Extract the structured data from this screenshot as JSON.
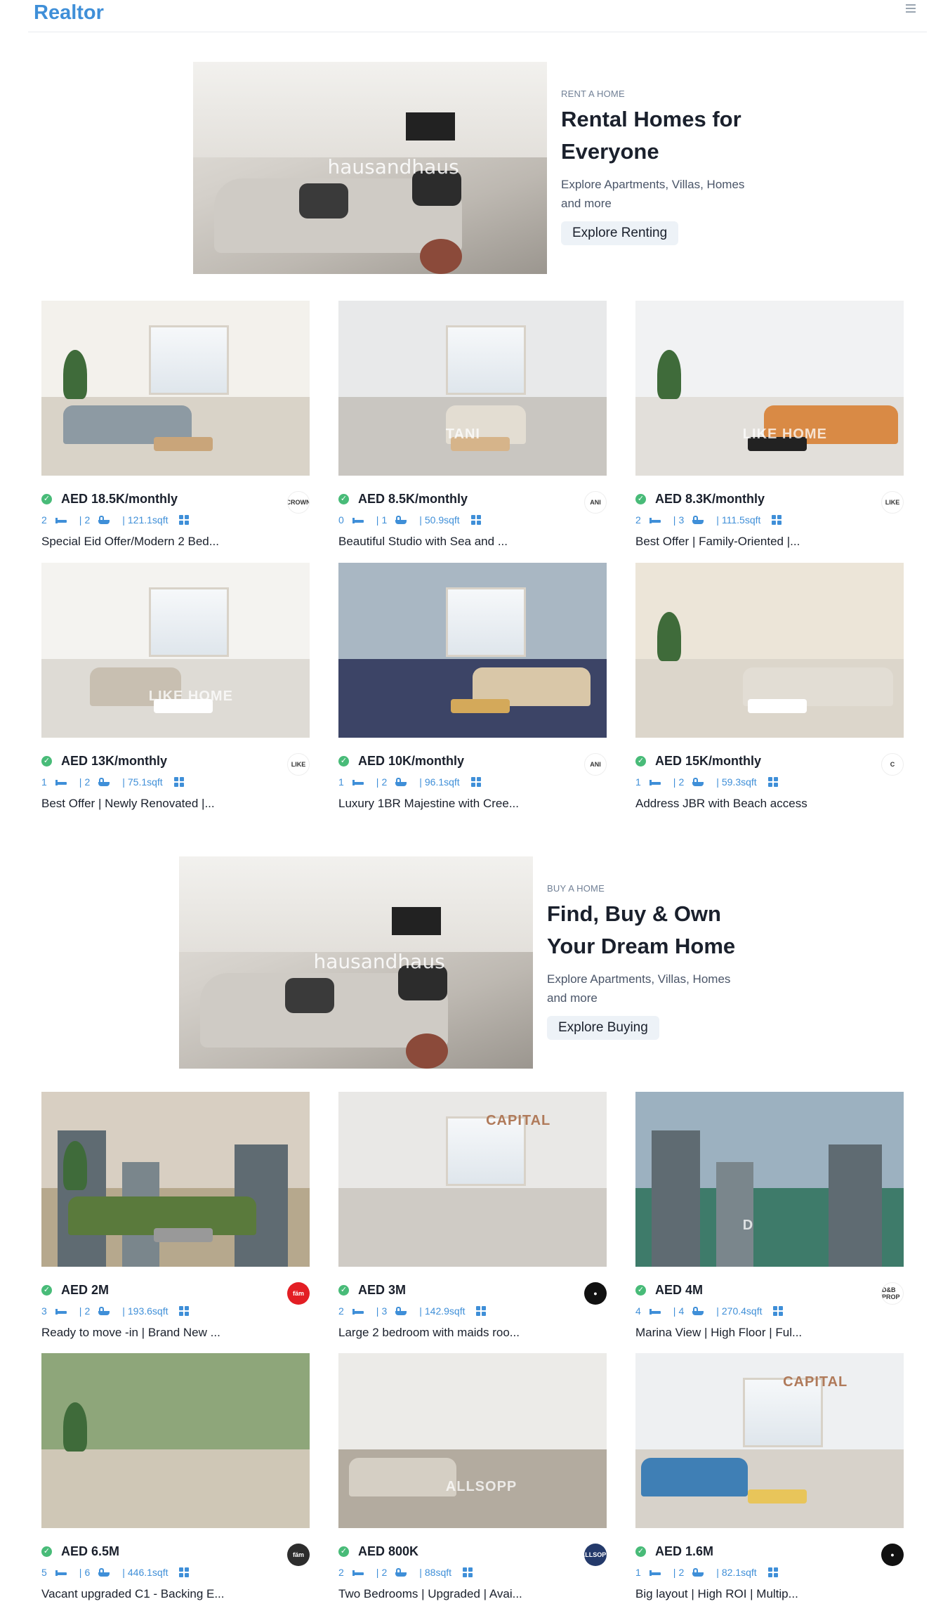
{
  "navbar": {
    "logo": "Realtor",
    "menu_icon": "menu-icon"
  },
  "rent_banner": {
    "tag": "RENT A HOME",
    "title": "Rental Homes for Everyone",
    "description": "Explore Apartments, Villas, Homes and more",
    "button": "Explore Renting",
    "image_watermark": "hausandhaus"
  },
  "buy_banner": {
    "tag": "BUY A HOME",
    "title": "Find, Buy & Own Your Dream Home",
    "description": "Explore Apartments, Villas, Homes and more",
    "button": "Explore Buying",
    "image_watermark": "hausandhaus"
  },
  "rent_listings": [
    {
      "price": "AED 18.5K/monthly",
      "rooms": "2",
      "baths": "2",
      "area": "121.1sqft",
      "title": "Special Eid Offer/Modern 2 Bed...",
      "agency": "CROWN",
      "agency_color": "#ffffff"
    },
    {
      "price": "AED 8.5K/monthly",
      "rooms": "0",
      "baths": "1",
      "area": "50.9sqft",
      "title": "Beautiful Studio with Sea and ...",
      "agency": "ANI",
      "agency_color": "#ffffff"
    },
    {
      "price": "AED 8.3K/monthly",
      "rooms": "2",
      "baths": "3",
      "area": "111.5sqft",
      "title": "Best Offer | Family-Oriented |...",
      "agency": "LIKE",
      "agency_color": "#ffffff"
    },
    {
      "price": "AED 13K/monthly",
      "rooms": "1",
      "baths": "2",
      "area": "75.1sqft",
      "title": "Best Offer | Newly Renovated |...",
      "agency": "LIKE",
      "agency_color": "#ffffff"
    },
    {
      "price": "AED 10K/monthly",
      "rooms": "1",
      "baths": "2",
      "area": "96.1sqft",
      "title": "Luxury 1BR Majestine with Cree...",
      "agency": "ANI",
      "agency_color": "#ffffff"
    },
    {
      "price": "AED 15K/monthly",
      "rooms": "1",
      "baths": "2",
      "area": "59.3sqft",
      "title": "Address JBR with Beach access",
      "agency": "C",
      "agency_color": "#ffffff"
    }
  ],
  "buy_listings": [
    {
      "price": "AED 2M",
      "rooms": "3",
      "baths": "2",
      "area": "193.6sqft",
      "title": "Ready to move -in | Brand New ...",
      "agency": "fäm",
      "agency_color": "#e31e24"
    },
    {
      "price": "AED 3M",
      "rooms": "2",
      "baths": "3",
      "area": "142.9sqft",
      "title": "Large 2 bedroom with maids roo...",
      "agency": "●",
      "agency_color": "#111111"
    },
    {
      "price": "AED 4M",
      "rooms": "4",
      "baths": "4",
      "area": "270.4sqft",
      "title": "Marina View | High Floor | Ful...",
      "agency": "D&B PROP",
      "agency_color": "#ffffff"
    },
    {
      "price": "AED 6.5M",
      "rooms": "5",
      "baths": "6",
      "area": "446.1sqft",
      "title": "Vacant upgraded C1 - Backing E...",
      "agency": "fäm",
      "agency_color": "#2d2d2d"
    },
    {
      "price": "AED 800K",
      "rooms": "2",
      "baths": "2",
      "area": "88sqft",
      "title": "Two Bedrooms | Upgraded | Avai...",
      "agency": "ALLSOPP",
      "agency_color": "#243a6b"
    },
    {
      "price": "AED 1.6M",
      "rooms": "1",
      "baths": "2",
      "area": "82.1sqft",
      "title": "Big layout | High ROI | Multip...",
      "agency": "●",
      "agency_color": "#111111"
    }
  ],
  "image_labels": {
    "rent_2": "TANI",
    "rent_3": "LIKE HOME",
    "rent_4": "LIKE HOME",
    "buy_2": "CAPITAL",
    "buy_3": "D",
    "buy_5": "ALLSOPP",
    "buy_6": "CAPITAL"
  },
  "colors": {
    "accent": "#3f8fd8",
    "verified": "#48bb78",
    "button_bg": "#edf2f7"
  }
}
